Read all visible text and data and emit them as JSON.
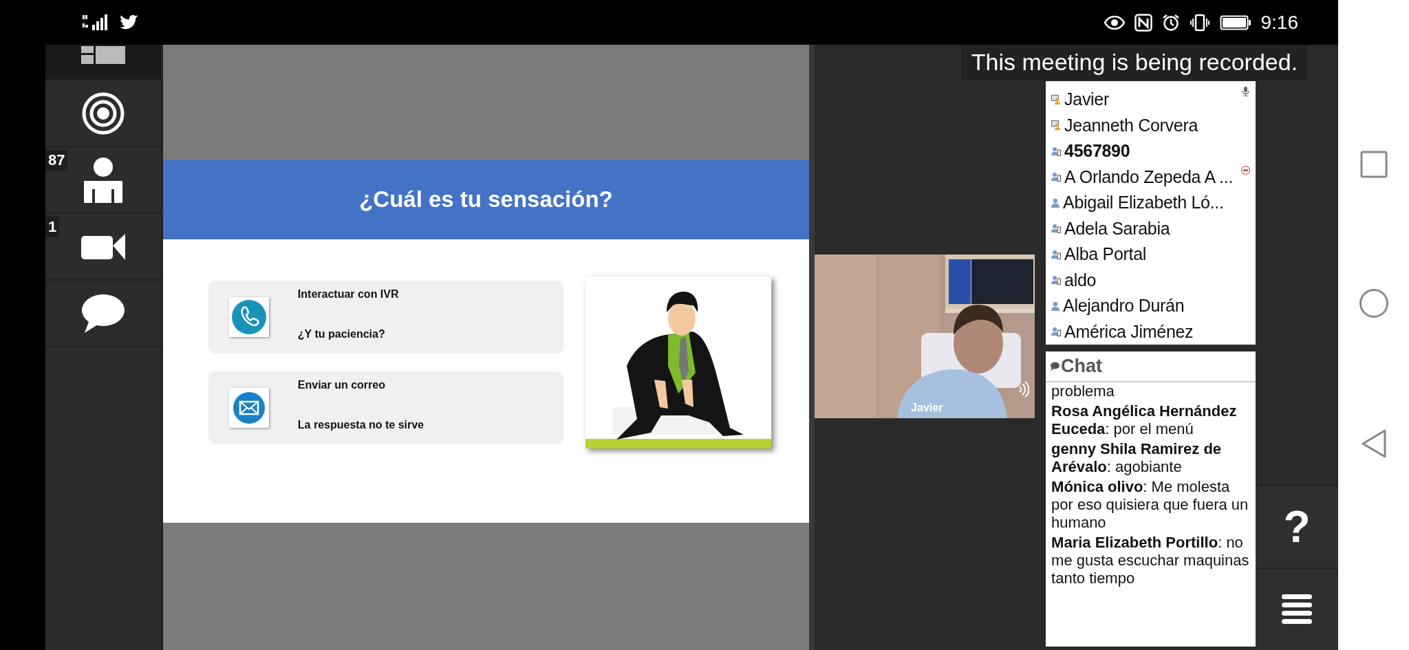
{
  "status_bar": {
    "time": "9:16"
  },
  "sidebar": {
    "items": [
      {
        "kind": "layout",
        "selected": true
      },
      {
        "kind": "broadcast",
        "selected": false
      },
      {
        "kind": "participants",
        "badge": "87",
        "selected": false
      },
      {
        "kind": "camera",
        "badge": "1",
        "selected": false
      },
      {
        "kind": "chat",
        "selected": false
      }
    ]
  },
  "slide": {
    "title": "¿Cuál es tu sensación?",
    "cards": [
      {
        "kind": "phone",
        "title": "Interactuar con IVR",
        "subtitle": "¿Y tu paciencia?"
      },
      {
        "kind": "mail",
        "title": "Enviar un correo",
        "subtitle": "La respuesta no te sirve"
      }
    ]
  },
  "recording_notice": "This meeting is being recorded.",
  "video": {
    "name": "Javier",
    "speaking": true
  },
  "participants": [
    {
      "name": "Javier",
      "kind": "presenter",
      "current_user": false,
      "speaking": true,
      "muted_status": false
    },
    {
      "name": "Jeanneth Corvera",
      "kind": "presenter",
      "current_user": false,
      "speaking": false,
      "muted_status": false
    },
    {
      "name": "4567890",
      "kind": "phone",
      "current_user": true,
      "speaking": false,
      "muted_status": false
    },
    {
      "name": "A Orlando Zepeda A ...",
      "kind": "phone",
      "current_user": false,
      "speaking": false,
      "muted_status": true
    },
    {
      "name": "Abigail Elizabeth Ló...",
      "kind": "user",
      "current_user": false,
      "speaking": false,
      "muted_status": false
    },
    {
      "name": "Adela Sarabia",
      "kind": "phone",
      "current_user": false,
      "speaking": false,
      "muted_status": false
    },
    {
      "name": "Alba Portal",
      "kind": "phone",
      "current_user": false,
      "speaking": false,
      "muted_status": false
    },
    {
      "name": "aldo",
      "kind": "phone",
      "current_user": false,
      "speaking": false,
      "muted_status": false
    },
    {
      "name": "Alejandro Durán",
      "kind": "user",
      "current_user": false,
      "speaking": false,
      "muted_status": false
    },
    {
      "name": "América Jiménez",
      "kind": "phone",
      "current_user": false,
      "speaking": false,
      "muted_status": false
    }
  ],
  "chat": {
    "title": "Chat",
    "messages": [
      {
        "text": "problema"
      },
      {
        "author": "Rosa Angélica Hernández Euceda",
        "separator": ":",
        "text": "por el menú"
      },
      {
        "author": "genny Shila Ramirez de Arévalo",
        "separator": ":",
        "text": "agobiante"
      },
      {
        "author": "Mónica olivo",
        "separator": ":",
        "text": "Me molesta por eso quisiera que fuera un humano"
      },
      {
        "author": "Maria Elizabeth Portillo",
        "separator": ":",
        "text": "no me gusta escuchar maquinas tanto tiempo"
      }
    ]
  },
  "help_label": "?"
}
